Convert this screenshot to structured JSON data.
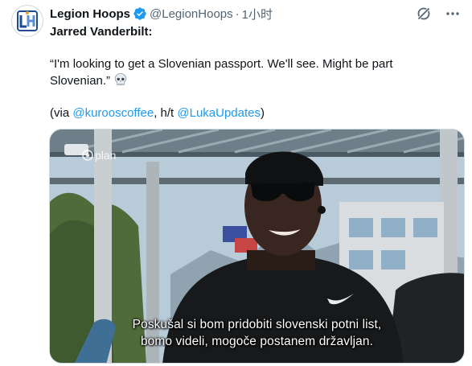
{
  "post": {
    "author_name": "Legion Hoops",
    "handle": "@LegionHoops",
    "separator": "·",
    "time": "1小时",
    "line1": "Jarred Vanderbilt:",
    "quote": "“I'm looking to get a Slovenian passport. We'll see. Might be part Slovenian.”",
    "via_prefix": "(via ",
    "via_link1": "@kurooscoffee",
    "via_mid": ", h/t ",
    "via_link2": "@LukaUpdates",
    "via_suffix": ")"
  },
  "media": {
    "watermark": "plan",
    "subtitle_line1": "Poskušal si bom pridobiti slovenski potni list,",
    "subtitle_line2": "bomo videli, mogoče postanem državljan."
  },
  "colors": {
    "link": "#1d9bf0",
    "verified": "#1d9bf0",
    "secondary_text": "#536471"
  },
  "icons": [
    "legion-hoops-logo-icon",
    "verified-badge-icon",
    "grok-icon",
    "more-icon",
    "skull-emoji-icon"
  ]
}
